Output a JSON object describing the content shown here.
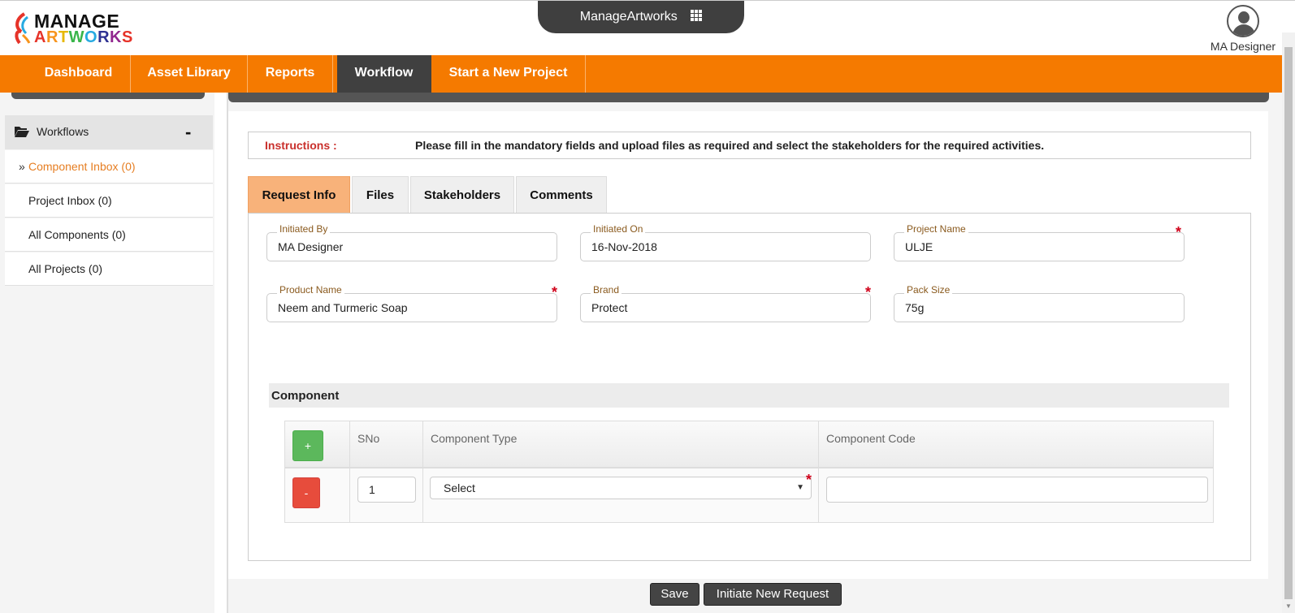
{
  "header": {
    "logo_line1": "MANAGE",
    "logo_line2_parts": [
      {
        "t": "A",
        "c": "#e63329"
      },
      {
        "t": "R",
        "c": "#f7941d"
      },
      {
        "t": "T",
        "c": "#e6b800"
      },
      {
        "t": "W",
        "c": "#39b54a"
      },
      {
        "t": "O",
        "c": "#27aae1"
      },
      {
        "t": "R",
        "c": "#2e3192"
      },
      {
        "t": "K",
        "c": "#92278f"
      },
      {
        "t": "S",
        "c": "#e63329"
      }
    ],
    "app_switcher": "ManageArtworks",
    "app_switcher_icon": "grid-icon",
    "user_name": "MA Designer",
    "user_icon": "avatar-icon"
  },
  "nav": {
    "items": [
      {
        "label": "Dashboard"
      },
      {
        "label": "Asset Library"
      },
      {
        "label": "Reports"
      },
      {
        "label": "Workflow",
        "active": true
      },
      {
        "label": "Start a New Project"
      }
    ],
    "colors": {
      "bar": "#f57a00",
      "active": "#404040"
    }
  },
  "sidebar": {
    "section_label": "Workflows",
    "section_icon": "folder-open-icon",
    "collapse_symbol": "-",
    "active_marker": "»",
    "items": [
      {
        "label": "Component Inbox (0)",
        "active": true
      },
      {
        "label": "Project Inbox (0)"
      },
      {
        "label": "All Components (0)"
      },
      {
        "label": "All Projects (0)"
      }
    ]
  },
  "instructions": {
    "label": "Instructions :",
    "text": "Please fill in the mandatory fields and upload files as required and select the stakeholders for the required activities."
  },
  "tabs": [
    {
      "label": "Request Info",
      "active": true
    },
    {
      "label": "Files"
    },
    {
      "label": "Stakeholders"
    },
    {
      "label": "Comments"
    }
  ],
  "form": {
    "initiated_by": {
      "label": "Initiated By",
      "value": "MA Designer"
    },
    "initiated_on": {
      "label": "Initiated On",
      "value": "16-Nov-2018"
    },
    "project_name": {
      "label": "Project Name",
      "value": "ULJE",
      "required": true
    },
    "product_name": {
      "label": "Product Name",
      "value": "Neem and Turmeric Soap",
      "required": true
    },
    "brand": {
      "label": "Brand",
      "value": "Protect",
      "required": true
    },
    "pack_size": {
      "label": "Pack Size",
      "value": "75g"
    },
    "required_marker": "*"
  },
  "component": {
    "title": "Component",
    "add_label": "+",
    "remove_label": "-",
    "columns": [
      "SNo",
      "Component Type",
      "Component Code"
    ],
    "rows": [
      {
        "sno": "1",
        "type": "Select",
        "code": ""
      }
    ],
    "select_arrow": "▼"
  },
  "actions": {
    "save": "Save",
    "initiate": "Initiate New Request"
  }
}
